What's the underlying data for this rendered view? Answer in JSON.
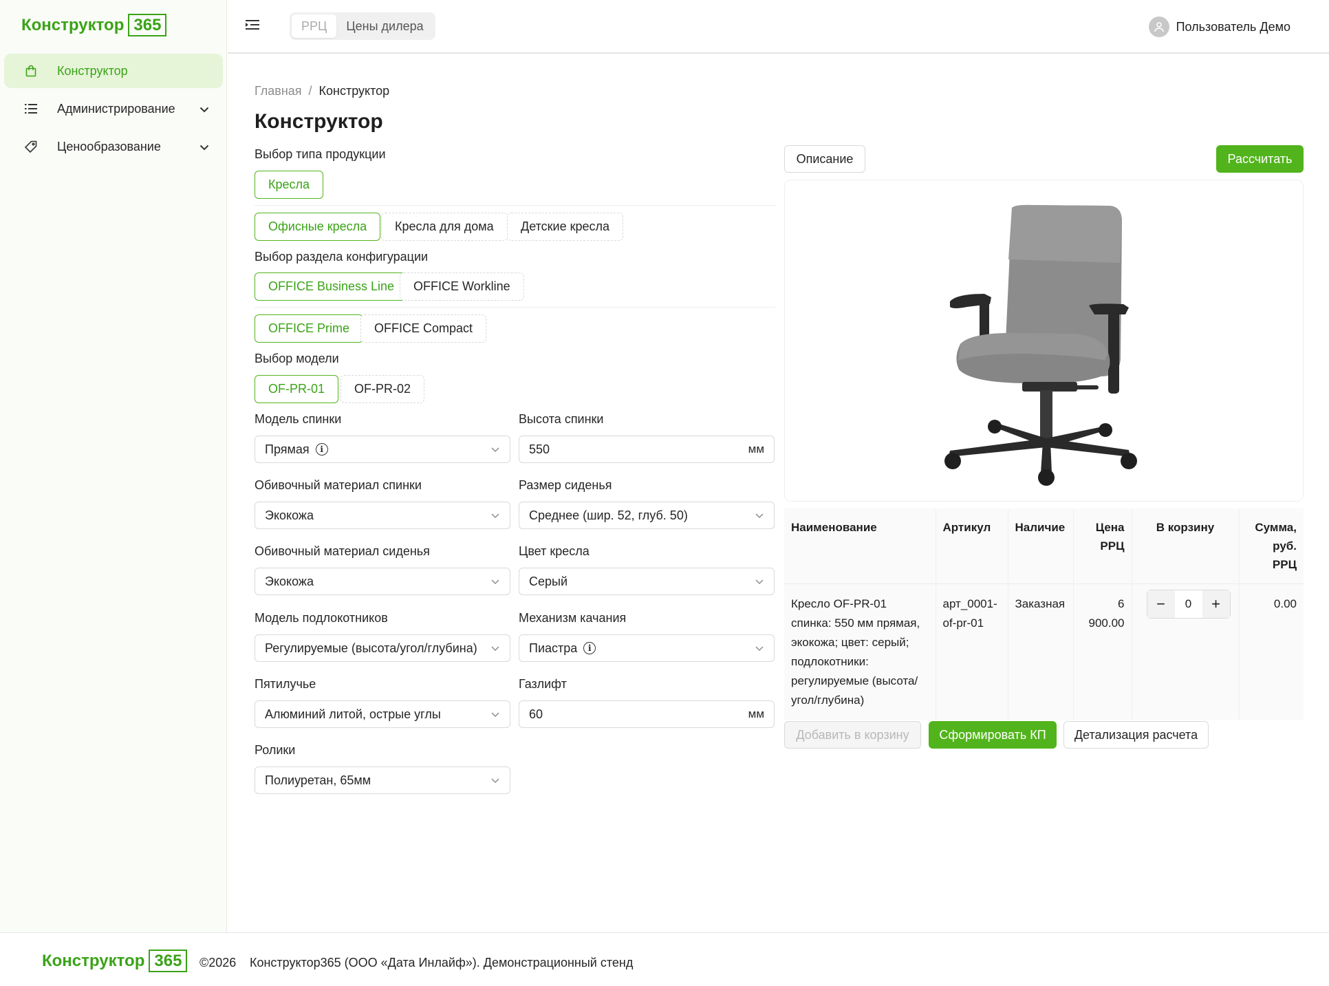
{
  "brand": {
    "name": "Конструктор",
    "num": "365",
    "color": "#3aa317"
  },
  "sidebar": {
    "items": [
      {
        "label": "Конструктор",
        "icon": "shopping-bag-icon",
        "active": true
      },
      {
        "label": "Администрирование",
        "icon": "list-icon",
        "expandable": true
      },
      {
        "label": "Ценообразование",
        "icon": "tag-icon",
        "expandable": true
      }
    ]
  },
  "header": {
    "price_modes": [
      "РРЦ",
      "Цены дилера"
    ],
    "user": "Пользователь Демо"
  },
  "breadcrumb": {
    "home": "Главная",
    "sep": "/",
    "current": "Конструктор"
  },
  "page_title": "Конструктор",
  "product_type": {
    "label": "Выбор типа продукции",
    "types": [
      "Кресла"
    ],
    "subtypes": [
      "Офисные кресла",
      "Кресла для дома",
      "Детские кресла"
    ]
  },
  "config_section": {
    "label": "Выбор раздела конфигурации",
    "lines": [
      "OFFICE Business Line",
      "OFFICE Workline"
    ],
    "series": [
      "OFFICE Prime",
      "OFFICE Compact"
    ]
  },
  "model": {
    "label": "Выбор модели",
    "options": [
      "OF-PR-01",
      "OF-PR-02"
    ]
  },
  "fields": {
    "back_model": {
      "label": "Модель спинки",
      "value": "Прямая"
    },
    "back_height": {
      "label": "Высота спинки",
      "value": "550",
      "unit": "мм"
    },
    "back_material": {
      "label": "Обивочный материал спинки",
      "value": "Экокожа"
    },
    "seat_size": {
      "label": "Размер сиденья",
      "value": "Среднее (шир. 52, глуб. 50)"
    },
    "seat_material": {
      "label": "Обивочный материал сиденья",
      "value": "Экокожа"
    },
    "chair_color": {
      "label": "Цвет кресла",
      "value": "Серый"
    },
    "armrest": {
      "label": "Модель подлокотников",
      "value": "Регулируемые (высота/угол/глубина)"
    },
    "mechanism": {
      "label": "Механизм качания",
      "value": "Пиастра"
    },
    "base": {
      "label": "Пятилучье",
      "value": "Алюминий литой, острые углы"
    },
    "gaslift": {
      "label": "Газлифт",
      "value": "60",
      "unit": "мм"
    },
    "casters": {
      "label": "Ролики",
      "value": "Полиуретан, 65мм"
    }
  },
  "actions": {
    "description": "Описание",
    "calculate": "Рассчитать"
  },
  "table": {
    "headers": [
      "Наименование",
      "Артикул",
      "Наличие",
      "Цена РРЦ",
      "В корзину",
      "Сумма, руб. РРЦ"
    ],
    "row": {
      "name": "Кресло OF-PR-01 спинка: 550 мм прямая, экокожа; цвет: серый; подлокотники: регулируемые (высота/угол/глубина)",
      "article": "арт_0001-of-pr-01",
      "availability": "Заказная",
      "price": "6 900.00",
      "qty": "0",
      "sum": "0.00"
    }
  },
  "bottom_buttons": {
    "add": "Добавить в корзину",
    "kp": "Сформировать КП",
    "details": "Детализация расчета"
  },
  "footer": {
    "copyright": "©2026",
    "text": "Конструктор365 (ООО «Дата Инлайф»). Демонстрационный стенд"
  }
}
